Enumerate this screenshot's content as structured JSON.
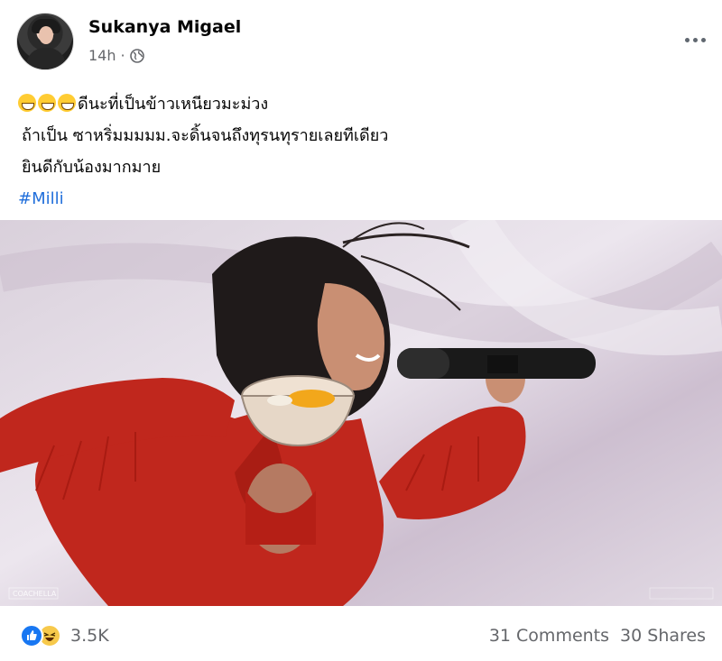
{
  "post": {
    "author": "Sukanya Migael",
    "time": "14h",
    "privacy_icon": "globe-icon",
    "text_line1": "ดีนะที่เป็นข้าวเหนียวมะม่วง",
    "text_line2": "ถ้าเป็น ซาหริ่มมมมม.จะดิ้นจนถึงทุรนทุรายเลยทีเดียว",
    "text_line3": "ยินดีกับน้องมากมาย",
    "hashtag": "#Milli",
    "emojis": [
      "grinning-face-emoji",
      "grinning-face-emoji",
      "grinning-face-emoji"
    ]
  },
  "photo": {
    "watermark_left": "COACHELLA"
  },
  "footer": {
    "reactions": [
      "like-icon",
      "haha-icon"
    ],
    "reaction_count": "3.5K",
    "comments": "31 Comments",
    "shares": "30 Shares"
  },
  "colors": {
    "link": "#216fdb",
    "like": "#1877f2",
    "secondary_text": "#65676b"
  }
}
